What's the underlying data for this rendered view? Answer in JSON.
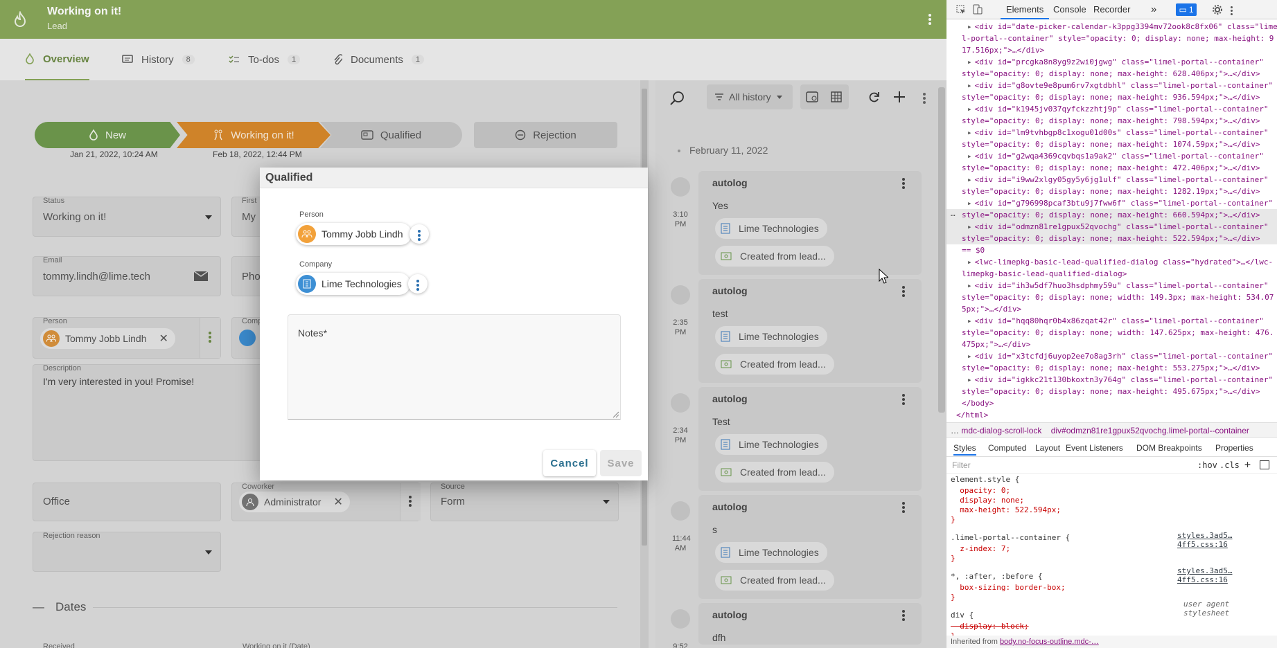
{
  "app": {
    "title": "Working on it!",
    "subtitle": "Lead",
    "tabs": [
      {
        "label": "Overview",
        "count": ""
      },
      {
        "label": "History",
        "count": "8"
      },
      {
        "label": "To-dos",
        "count": "1"
      },
      {
        "label": "Documents",
        "count": "1"
      }
    ],
    "progress": {
      "steps": [
        {
          "label": "New",
          "date": "Jan 21, 2022, 10:24 AM"
        },
        {
          "label": "Working on it!",
          "date": "Feb 18, 2022, 12:44 PM"
        },
        {
          "label": "Qualified",
          "date": ""
        }
      ],
      "rejection": "Rejection"
    },
    "fields": {
      "status_label": "Status",
      "status_value": "Working on it!",
      "first_label": "First",
      "first_value": "My",
      "email_label": "Email",
      "email_value": "tommy.lindh@lime.tech",
      "phone_value": "Pho",
      "person_label": "Person",
      "person_value": "Tommy Jobb Lindh",
      "company_label": "Comp",
      "description_label": "Description",
      "description_value": "I'm very interested in you! Promise!",
      "office_value": "Office",
      "coworker_label": "Coworker",
      "coworker_value": "Administrator",
      "source_label": "Source",
      "source_value": "Form",
      "rejection_label": "Rejection reason",
      "dates_header": "Dates",
      "received_label": "Received",
      "working_date_label": "Working on it (Date)"
    }
  },
  "history": {
    "filter": "All history",
    "date_header": "February 11, 2022",
    "entries": [
      {
        "author": "autolog",
        "time": "3:10 PM",
        "text": "Yes"
      },
      {
        "author": "autolog",
        "time": "2:35 PM",
        "text": "test"
      },
      {
        "author": "autolog",
        "time": "2:34 PM",
        "text": "Test"
      },
      {
        "author": "autolog",
        "time": "11:44 AM",
        "text": "s"
      },
      {
        "author": "autolog",
        "time": "9:52",
        "text": "dfh"
      }
    ],
    "pill_company": "Lime Technologies",
    "pill_created": "Created from lead..."
  },
  "modal": {
    "title": "Qualified",
    "person_label": "Person",
    "person_value": "Tommy Jobb Lindh",
    "company_label": "Company",
    "company_value": "Lime Technologies",
    "notes_placeholder": "Notes*",
    "cancel": "Cancel",
    "save": "Save"
  },
  "devtools": {
    "tabs": [
      "Elements",
      "Console",
      "Recorder"
    ],
    "issues_count": "1",
    "dom_lines": [
      "<div id=\"date-picker-calendar-k3ppg3394mv72ook8c8fx06\" class=\"lime",
      "l-portal--container\" style=\"opacity: 0; display: none; max-height: 9",
      "17.516px;\">…</div>",
      "<div id=\"prcgka8n8yg9z2wi0jgwg\" class=\"limel-portal--container\"",
      "style=\"opacity: 0; display: none; max-height: 628.406px;\">…</div>",
      "<div id=\"g8ovte9e8pum6rv7xgtdbhl\" class=\"limel-portal--container\"",
      "style=\"opacity: 0; display: none; max-height: 936.594px;\">…</div>",
      "<div id=\"k1945jv037qyfckzzhtj9p\" class=\"limel-portal--container\"",
      "style=\"opacity: 0; display: none; max-height: 798.594px;\">…</div>",
      "<div id=\"lm9tvhbgp8c1xogu01d00s\" class=\"limel-portal--container\"",
      "style=\"opacity: 0; display: none; max-height: 1074.59px;\">…</div>",
      "<div id=\"g2wqa4369cqvbqs1a9ak2\" class=\"limel-portal--container\"",
      "style=\"opacity: 0; display: none; max-height: 472.406px;\">…</div>",
      "<div id=\"i9ww2xlgy05gy5y6jg1ulf\" class=\"limel-portal--container\"",
      "style=\"opacity: 0; display: none; max-height: 1282.19px;\">…</div>",
      "<div id=\"g796998pcaf3btu9j7fww6f\" class=\"limel-portal--container\"",
      "style=\"opacity: 0; display: none; max-height: 660.594px;\">…</div>",
      "<div id=\"odmzn81re1gpux52qvochg\" class=\"limel-portal--container\"",
      "style=\"opacity: 0; display: none; max-height: 522.594px;\">…</div>",
      "== $0",
      "<lwc-limepkg-basic-lead-qualified-dialog class=\"hydrated\">…</lwc-",
      "limepkg-basic-lead-qualified-dialog>",
      "<div id=\"ih3w5df7huo3hsdphmy59u\" class=\"limel-portal--container\"",
      "style=\"opacity: 0; display: none; width: 149.3px; max-height: 534.07",
      "5px;\">…</div>",
      "<div id=\"hqq80hqr0b4x86zqat42r\" class=\"limel-portal--container\"",
      "style=\"opacity: 0; display: none; width: 147.625px; max-height: 476.",
      "475px;\">…</div>",
      "<div id=\"x3tcfdj6uyop2ee7o8ag3rh\" class=\"limel-portal--container\"",
      "style=\"opacity: 0; display: none; max-height: 553.275px;\">…</div>",
      "<div id=\"igkkc21t130bkoxtn3y764g\" class=\"limel-portal--container\"",
      "style=\"opacity: 0; display: none; max-height: 495.675px;\">…</div>",
      "</body>",
      "</html>"
    ],
    "breadcrumb_1": "mdc-dialog-scroll-lock",
    "breadcrumb_2": "div#odmzn81re1gpux52qvochg.limel-portal--container",
    "styles_tabs": [
      "Styles",
      "Computed",
      "Layout",
      "Event Listeners",
      "DOM Breakpoints",
      "Properties"
    ],
    "filter_placeholder": "Filter",
    "hov": ":hov",
    "cls": ".cls",
    "rules": [
      "element.style {",
      "  opacity: 0;",
      "  display: none;",
      "  max-height: 522.594px;",
      "}",
      ".limel-portal--container {",
      "  z-index: 7;",
      "}",
      "*, :after, :before {",
      "  box-sizing: border-box;",
      "}",
      "div {",
      "  display: block;",
      "}"
    ],
    "rule_source_1": "styles.3ad5…4ff5.css:16",
    "rule_source_2": "styles.3ad5…4ff5.css:16",
    "rule_source_3": "user agent stylesheet",
    "inherited": "Inherited from",
    "inherited_from": "body.no-focus-outline.mdc-…"
  }
}
